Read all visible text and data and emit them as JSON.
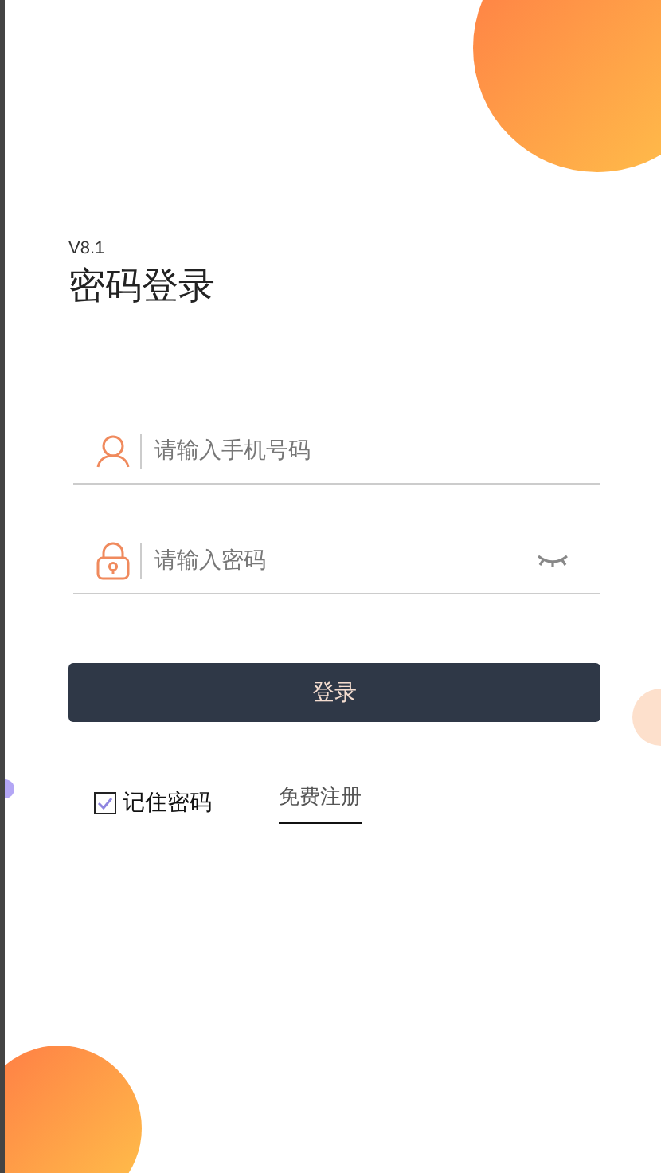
{
  "version": "V8.1",
  "title": "密码登录",
  "fields": [
    {
      "kind": "phone",
      "placeholder": "请输入手机号码"
    },
    {
      "kind": "password",
      "placeholder": "请输入密码"
    }
  ],
  "login_button": "登录",
  "remember": {
    "label": "记住密码",
    "checked": true
  },
  "register_link": "免费注册"
}
